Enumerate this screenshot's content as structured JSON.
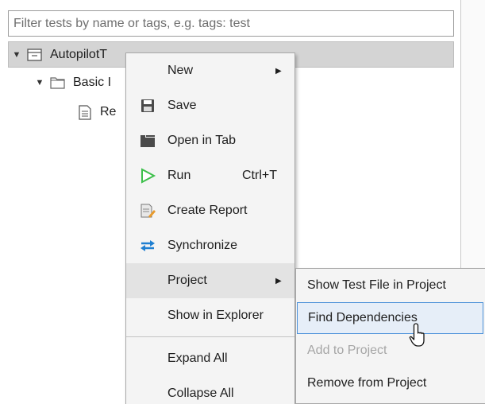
{
  "filter": {
    "placeholder": "Filter tests by name or tags, e.g. tags: test",
    "value": ""
  },
  "tree": {
    "root": {
      "label": "AutopilotT",
      "icon": "test-file-icon",
      "expanded": true
    },
    "child": {
      "label": "Basic I",
      "icon": "folder-icon",
      "expanded": true
    },
    "grandchild": {
      "label": "Re",
      "icon": "document-icon"
    }
  },
  "context_menu": {
    "items": [
      {
        "label": "New",
        "icon": "",
        "submenu": true
      },
      {
        "label": "Save",
        "icon": "save-icon"
      },
      {
        "label": "Open in Tab",
        "icon": "open-tab-icon"
      },
      {
        "label": "Run",
        "icon": "run-icon",
        "shortcut": "Ctrl+T"
      },
      {
        "label": "Create Report",
        "icon": "report-icon"
      },
      {
        "label": "Synchronize",
        "icon": "synchronize-icon"
      },
      {
        "label": "Project",
        "icon": "",
        "submenu": true,
        "highlighted": true
      },
      {
        "label": "Show in Explorer",
        "icon": ""
      },
      {
        "label": "Expand All",
        "icon": ""
      },
      {
        "label": "Collapse All",
        "icon": ""
      }
    ]
  },
  "project_submenu": {
    "items": [
      {
        "label": "Show Test File in Project",
        "enabled": true
      },
      {
        "label": "Find Dependencies",
        "enabled": true,
        "highlighted": true
      },
      {
        "label": "Add to Project",
        "enabled": false
      },
      {
        "label": "Remove from Project",
        "enabled": true
      }
    ]
  },
  "colors": {
    "run_green": "#3cbf4a",
    "sync_blue": "#1f7fd1",
    "highlight_border": "#4a90d9"
  }
}
